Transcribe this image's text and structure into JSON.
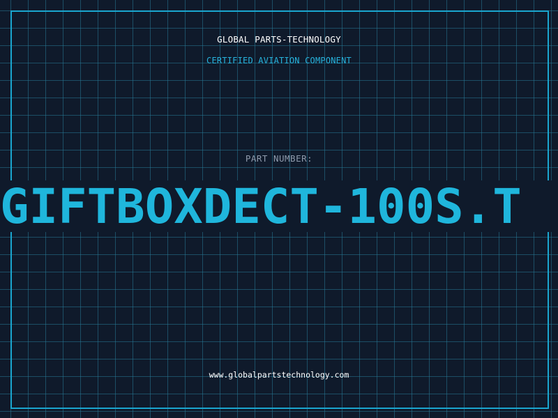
{
  "brand": {
    "name": "GLOBAL PARTS-TECHNOLOGY",
    "tagline": "CERTIFIED AVIATION COMPONENT"
  },
  "part": {
    "label": "PART NUMBER:",
    "number": "GIFTBOXDECT-100S.T"
  },
  "footer": {
    "url": "www.globalpartstechnology.com"
  },
  "colors": {
    "background": "#0f1a2b",
    "grid": "#267896",
    "frame": "#1aa6cf",
    "accent": "#1fb6dc",
    "label": "#8e9aac",
    "text": "#ffffff"
  }
}
